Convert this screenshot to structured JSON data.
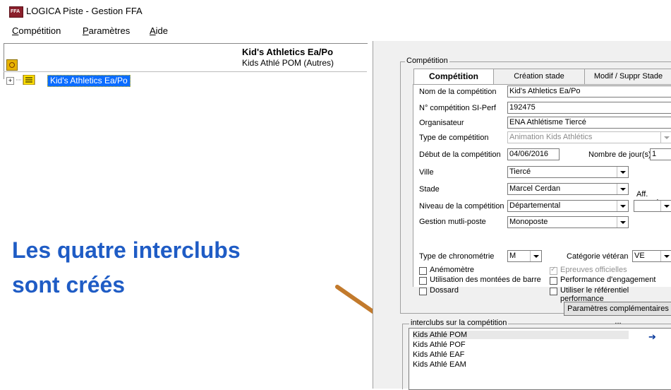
{
  "window": {
    "title": "LOGICA Piste - Gestion FFA",
    "icon": "app-logo-icon"
  },
  "menu": [
    {
      "label": "Compétition",
      "accel": "C"
    },
    {
      "label": "Paramètres",
      "accel": "P"
    },
    {
      "label": "Aide",
      "accel": "A"
    }
  ],
  "tree": {
    "header_title": "Kid's Athletics Ea/Po",
    "header_sub": "Kids Athlé POM (Autres)",
    "node_label": "Kid's Athletics Ea/Po"
  },
  "annotation": {
    "line1": "Les quatre interclubs",
    "line2": "sont créés"
  },
  "panel": {
    "group_label": "Compétition",
    "tabs": [
      "Compétition",
      "Création stade",
      "Modif / Suppr Stade"
    ],
    "fields": {
      "nom_label": "Nom de la compétition",
      "nom_value": "Kid's Athletics Ea/Po",
      "num_label": "N° compétition SI-Perf",
      "num_value": "192475",
      "org_label": "Organisateur",
      "org_value": "ENA Athlétisme Tiercé",
      "type_label": "Type de compétition",
      "type_value": "Animation Kids Athlétics",
      "debut_label": "Début de la compétition",
      "debut_value": "04/06/2016",
      "nbjours_label": "Nombre de jour(s)",
      "nbjours_value": "1",
      "ville_label": "Ville",
      "ville_value": "Tiercé",
      "stade_label": "Stade",
      "stade_value": "Marcel Cerdan",
      "affrecord_label": "Aff. record",
      "niveau_label": "Niveau de la compétition",
      "niveau_value": "Départemental",
      "gestion_label": "Gestion mutli-poste",
      "gestion_value": "Monoposte",
      "chrono_label": "Type de chronométrie",
      "chrono_value": "M",
      "veteran_label": "Catégorie vétéran",
      "veteran_value": "VE"
    },
    "checks": {
      "anemometre": "Anémomètre",
      "montees": "Utilisation des montées de barre",
      "dossard": "Dossard",
      "epreuves": "Epreuves officielles",
      "perf_engagement": "Performance d'engagement",
      "referentiel": "Utiliser le référentiel performance"
    },
    "params_button": "Paramètres complémentaires ...",
    "interclubs_label": "interclubs sur la compétition",
    "interclubs": [
      "Kids Athlé POM",
      "Kids Athlé POF",
      "Kids Athlé EAF",
      "Kids Athlé EAM"
    ]
  },
  "colors": {
    "annotation": "#1f5cc5",
    "selection": "#0a6cff",
    "arrow": "#c27a2c"
  }
}
